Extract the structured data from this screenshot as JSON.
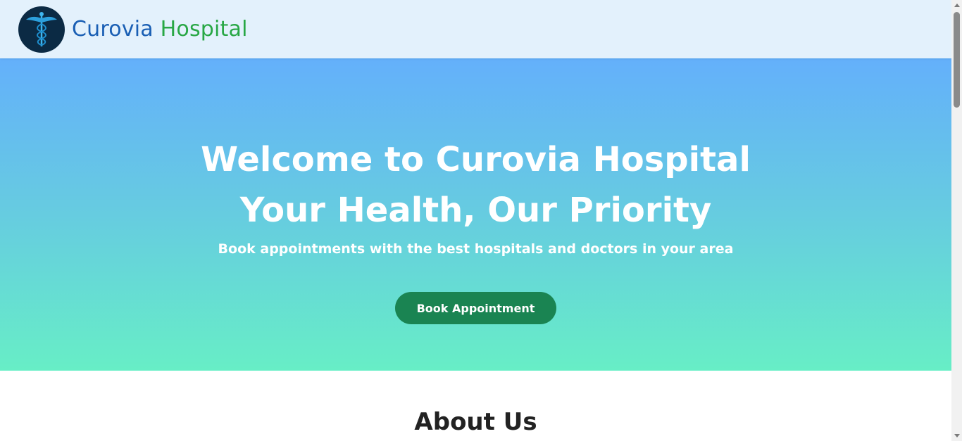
{
  "header": {
    "brand_primary": "Curovia",
    "brand_secondary": "Hospital",
    "logo_icon": "caduceus-icon"
  },
  "hero": {
    "title_line1": "Welcome to Curovia Hospital",
    "title_line2": "Your Health, Our Priority",
    "subtitle": "Book appointments with the best hospitals and doctors in your area",
    "cta_label": "Book Appointment"
  },
  "about": {
    "heading": "About Us"
  },
  "colors": {
    "brand_blue": "#1a5fb4",
    "brand_green": "#28a745",
    "cta_green": "#1a8452",
    "hero_gradient_top": "#64b0fb",
    "hero_gradient_bottom": "#67eec6",
    "header_bg": "#e3f1fc"
  }
}
